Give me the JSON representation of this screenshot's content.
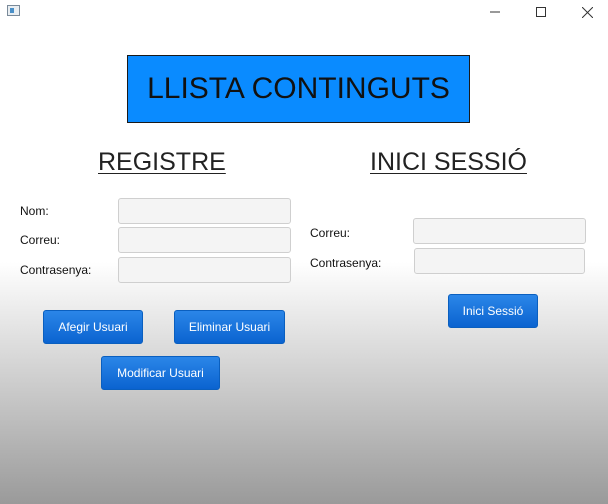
{
  "window": {
    "controls": {
      "minimize_icon": "minimize-icon",
      "maximize_icon": "maximize-icon",
      "close_icon": "close-icon"
    }
  },
  "main_title": "LLISTA CONTINGUTS",
  "registre": {
    "heading": "REGISTRE",
    "fields": [
      {
        "label": "Nom:",
        "value": ""
      },
      {
        "label": "Correu:",
        "value": ""
      },
      {
        "label": "Contrasenya:",
        "value": ""
      }
    ],
    "buttons": {
      "afegir": "Afegir Usuari",
      "eliminar": "Eliminar Usuari",
      "modificar": "Modificar Usuari"
    }
  },
  "login": {
    "heading": "INICI SESSIÓ",
    "fields": [
      {
        "label": "Correu:",
        "value": ""
      },
      {
        "label": "Contrasenya:",
        "value": ""
      }
    ],
    "button": "Inici Sessió"
  },
  "colors": {
    "title_box": "#0a8bff",
    "button": "#0b63d0"
  }
}
